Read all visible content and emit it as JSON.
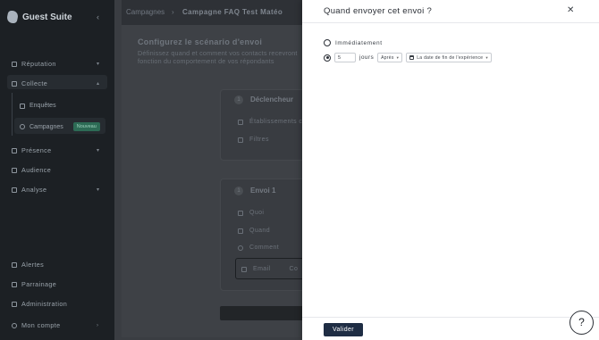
{
  "sidebar": {
    "brand": "Guest Suite",
    "items": [
      {
        "label": "Réputation"
      },
      {
        "label": "Collecte"
      },
      {
        "label": "Présence"
      },
      {
        "label": "Audience"
      },
      {
        "label": "Analyse"
      }
    ],
    "sub_items": [
      {
        "label": "Enquêtes"
      },
      {
        "label": "Campagnes",
        "badge": "Nouveau"
      }
    ],
    "bottom_items": [
      {
        "label": "Alertes"
      },
      {
        "label": "Parrainage"
      },
      {
        "label": "Administration"
      },
      {
        "label": "Mon compte"
      }
    ]
  },
  "breadcrumb": {
    "parent": "Campagnes",
    "current": "Campagne FAQ Test Matéo"
  },
  "main": {
    "heading": "Configurez le scénario d'envoi",
    "description": "Définissez quand et comment vos contacts recevront fonction du comportement de vos répondants",
    "trigger": {
      "number": "1",
      "title": "Déclencheur",
      "rows": [
        "Établissements c",
        "Filtres"
      ]
    },
    "send": {
      "number": "1",
      "title": "Envoi 1",
      "rows": [
        "Quoi",
        "Quand",
        "Comment"
      ],
      "channel": "Email",
      "channel_extra": "Co"
    }
  },
  "modal": {
    "title": "Quand envoyer cet envoi ?",
    "option_immediate": "Immédiatement",
    "delay_value": "5",
    "delay_unit": "jours",
    "relation_select": "Après",
    "reference_select": "La date de fin de l'expérience",
    "validate_label": "Valider",
    "help_label": "?"
  }
}
